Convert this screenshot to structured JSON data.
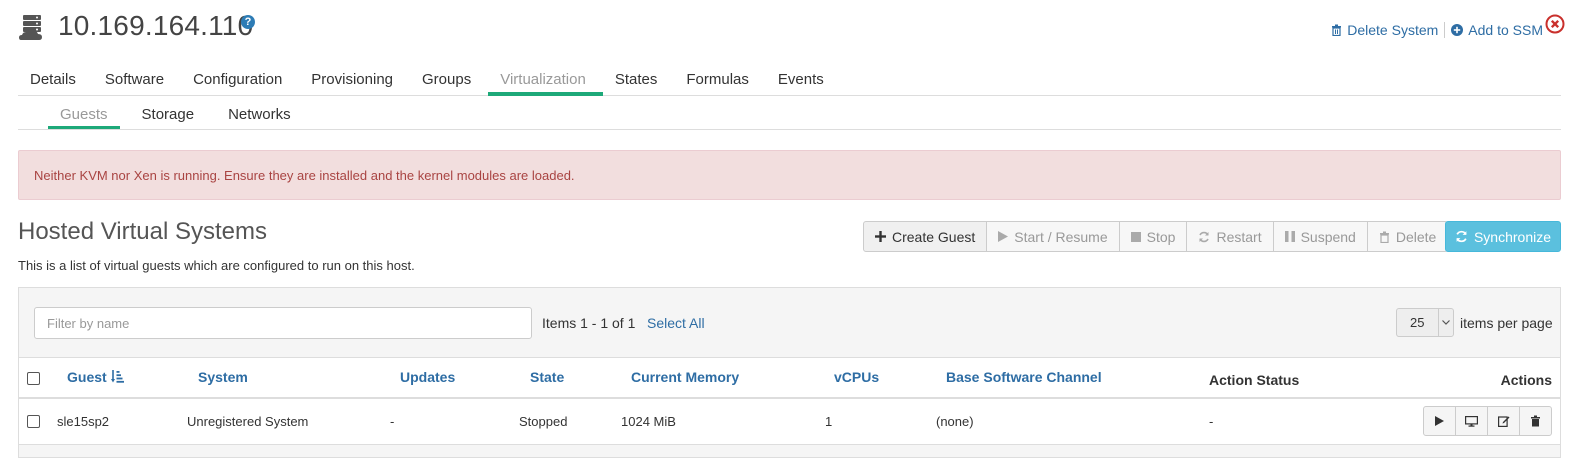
{
  "header": {
    "title": "10.169.164.110",
    "help_icon": "question-circle-icon",
    "delete_system": "Delete System",
    "add_to_ssm": "Add to SSM"
  },
  "tabs": [
    "Details",
    "Software",
    "Configuration",
    "Provisioning",
    "Groups",
    "Virtualization",
    "States",
    "Formulas",
    "Events"
  ],
  "active_tab": "Virtualization",
  "subtabs": [
    "Guests",
    "Storage",
    "Networks"
  ],
  "active_subtab": "Guests",
  "alert": {
    "message": "Neither KVM nor Xen is running. Ensure they are installed and the kernel modules are loaded."
  },
  "section": {
    "title": "Hosted Virtual Systems",
    "description": "This is a list of virtual guests which are configured to run on this host."
  },
  "toolbar": {
    "create_guest": "Create Guest",
    "start_resume": "Start / Resume",
    "stop": "Stop",
    "restart": "Restart",
    "suspend": "Suspend",
    "delete": "Delete",
    "synchronize": "Synchronize"
  },
  "list": {
    "filter_placeholder": "Filter by name",
    "items_count": "Items 1 - 1 of 1",
    "select_all": "Select All",
    "per_page_value": "25",
    "per_page_label": "items per page",
    "columns": {
      "guest": "Guest",
      "system": "System",
      "updates": "Updates",
      "state": "State",
      "current_memory": "Current Memory",
      "vcpus": "vCPUs",
      "base_channel": "Base Software Channel",
      "action_status": "Action Status",
      "actions": "Actions"
    },
    "rows": [
      {
        "guest": "sle15sp2",
        "system": "Unregistered System",
        "updates": "-",
        "state": "Stopped",
        "current_memory": "1024 MiB",
        "vcpus": "1",
        "base_channel": "(none)",
        "action_status": "-"
      }
    ]
  },
  "colors": {
    "link": "#2e6da4",
    "accent_green": "#1da979",
    "alert_bg": "#f2dede",
    "alert_text": "#a94442",
    "sync_button": "#5bc0de"
  }
}
